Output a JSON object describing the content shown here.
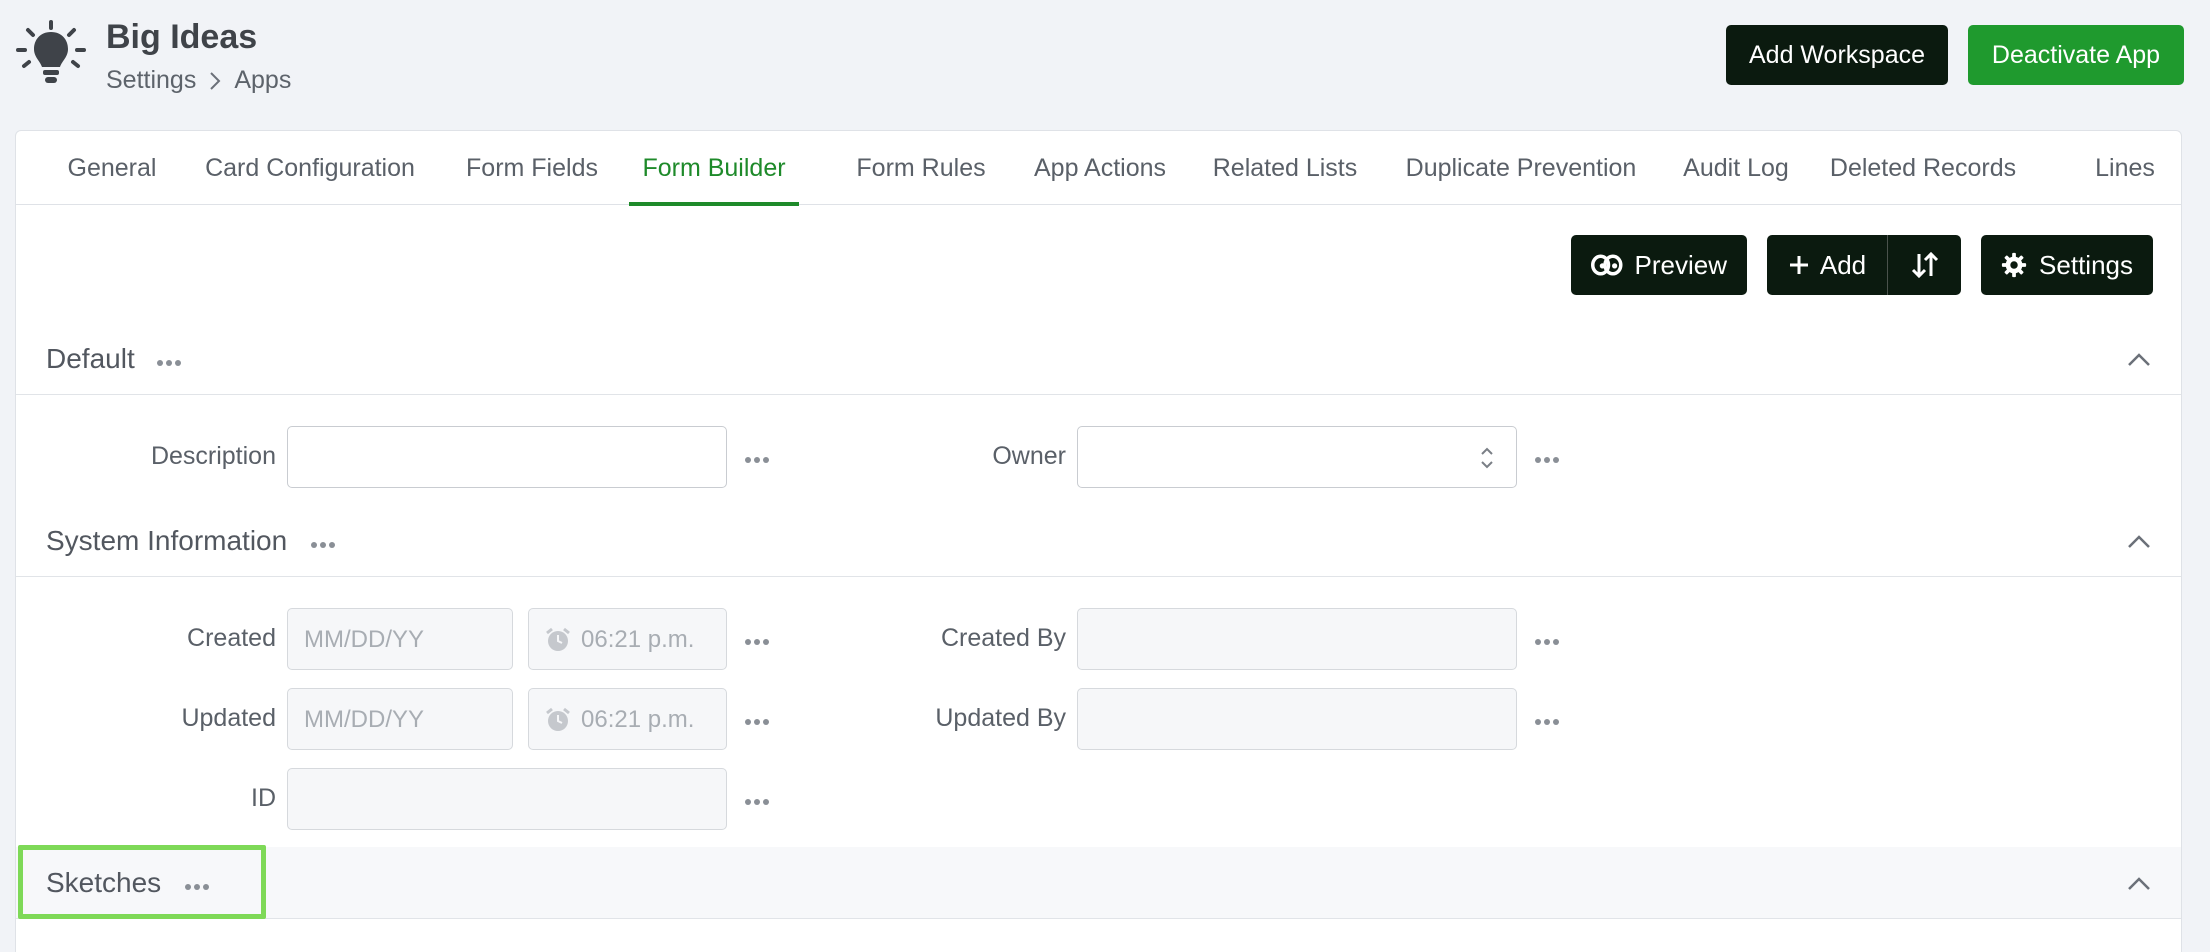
{
  "header": {
    "title": "Big Ideas",
    "breadcrumb": [
      "Settings",
      "Apps"
    ],
    "add_workspace_label": "Add Workspace",
    "deactivate_label": "Deactivate App"
  },
  "tabs": [
    {
      "label": "General"
    },
    {
      "label": "Card Configuration"
    },
    {
      "label": "Form Fields"
    },
    {
      "label": "Form Builder",
      "active": true
    },
    {
      "label": "Form Rules"
    },
    {
      "label": "App Actions"
    },
    {
      "label": "Related Lists"
    },
    {
      "label": "Duplicate Prevention"
    },
    {
      "label": "Audit Log"
    },
    {
      "label": "Deleted Records"
    },
    {
      "label": "Lines"
    }
  ],
  "toolbar": {
    "preview_label": "Preview",
    "add_label": "Add",
    "settings_label": "Settings"
  },
  "sections": {
    "default": {
      "title": "Default",
      "description_label": "Description",
      "owner_label": "Owner"
    },
    "system": {
      "title": "System Information",
      "created_label": "Created",
      "updated_label": "Updated",
      "id_label": "ID",
      "created_by_label": "Created By",
      "updated_by_label": "Updated By",
      "date_placeholder": "MM/DD/YY",
      "time_placeholder": "06:21 p.m."
    },
    "sketches": {
      "title": "Sketches"
    }
  },
  "colors": {
    "accent": "#1e8a2a",
    "dark_button": "#0b1a0f",
    "green_button": "#1f9a2e",
    "highlight": "#7ed957"
  }
}
